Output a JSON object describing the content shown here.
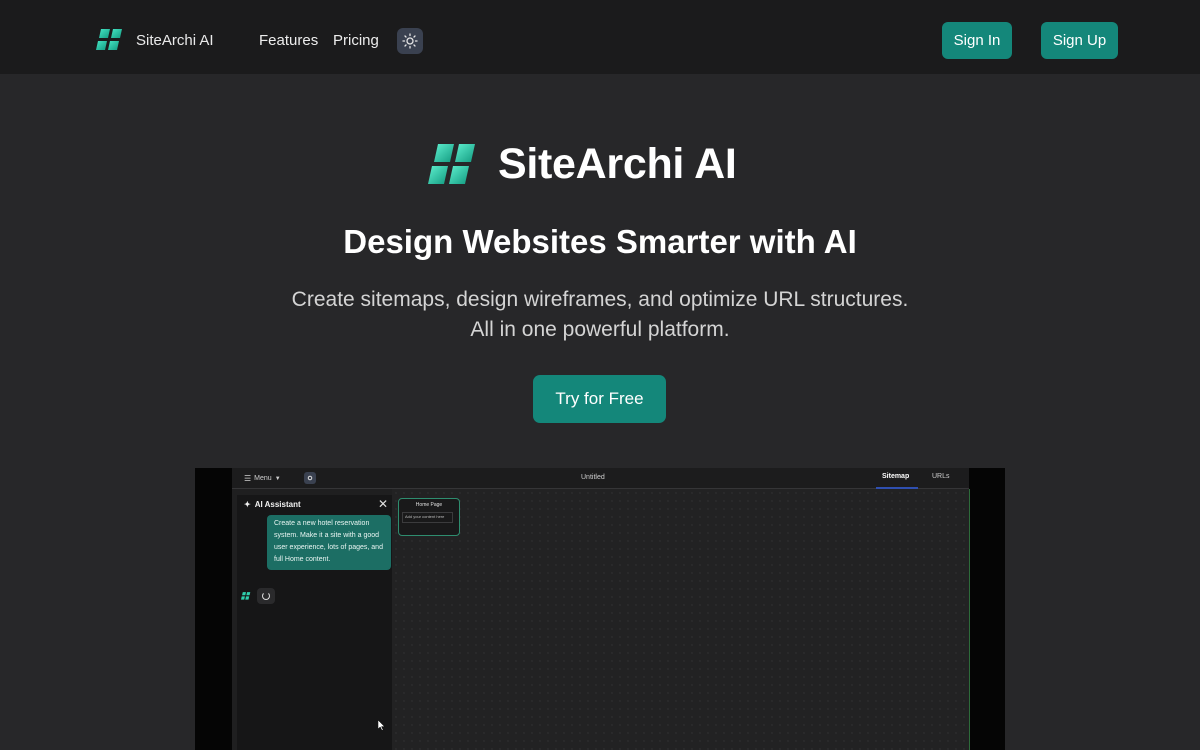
{
  "colors": {
    "accent": "#14877a",
    "nav_bg": "#1b1b1c",
    "page_bg": "#272729"
  },
  "nav": {
    "brand": "SiteArchi AI",
    "links": [
      "Features",
      "Pricing"
    ],
    "sign_in": "Sign In",
    "sign_up": "Sign Up"
  },
  "hero": {
    "brand": "SiteArchi AI",
    "headline": "Design Websites Smarter with AI",
    "sub_line1": "Create sitemaps, design wireframes, and optimize URL structures.",
    "sub_line2": "All in one powerful platform.",
    "cta": "Try for Free"
  },
  "preview": {
    "menu_label": "Menu",
    "doc_title": "Untitled",
    "tabs": [
      "Sitemap",
      "URLs"
    ],
    "panel_title": "AI Assistant",
    "message": "Create a new hotel reservation system. Make it a site with a good user experience, lots of pages, and full Home content.",
    "node_title": "Home Page",
    "node_placeholder": "Add your content here"
  }
}
